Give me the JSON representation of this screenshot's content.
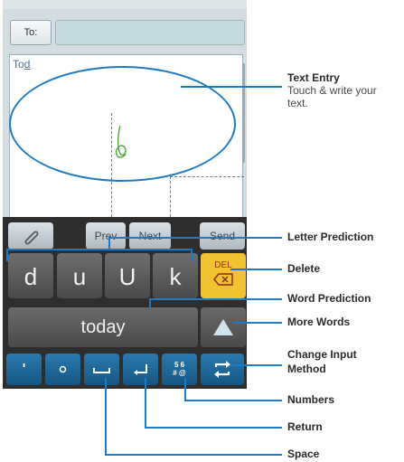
{
  "compose": {
    "to_label": "To:",
    "typed_text_prefix": "To",
    "typed_text_underlined": "d"
  },
  "keyboard": {
    "toolbar": {
      "attach_icon": "paperclip-icon",
      "prev_label": "Prev",
      "next_label": "Next",
      "send_label": "Send"
    },
    "letter_predictions": [
      "d",
      "u",
      "U",
      "k"
    ],
    "delete_label": "DEL",
    "word_prediction": "today",
    "bottom_row": {
      "apostrophe": "'",
      "dot": "°",
      "numbers_line1": "5 6",
      "numbers_line2": "# @"
    }
  },
  "callouts": {
    "text_entry_title": "Text Entry",
    "text_entry_desc_line1": "Touch & write your",
    "text_entry_desc_line2": "text.",
    "letter_prediction": "Letter Prediction",
    "delete": "Delete",
    "word_prediction": "Word Prediction",
    "more_words": "More  Words",
    "change_input_line1": "Change Input",
    "change_input_line2": "Method",
    "numbers": "Numbers",
    "return": "Return",
    "space": "Space"
  },
  "colors": {
    "callout_blue": "#1d7ac6",
    "delete_yellow": "#f1c232",
    "bottom_key_blue": "#1f6a9c"
  }
}
